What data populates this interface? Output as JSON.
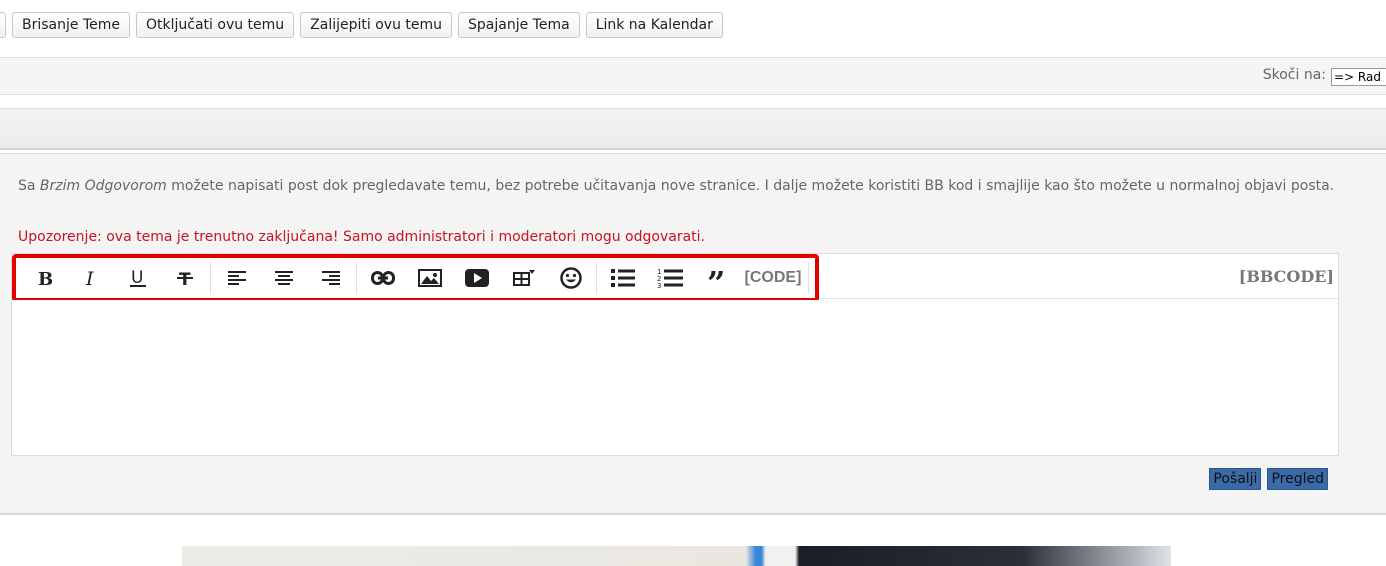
{
  "moderation": {
    "buttons": [
      "Brisanje Teme",
      "Otključati ovu temu",
      "Zalijepiti ovu temu",
      "Spajanje Tema",
      "Link na Kalendar"
    ]
  },
  "jump": {
    "label": "Skoči na:",
    "selected": "=> Rad"
  },
  "quick_reply": {
    "intro_prefix": "Sa",
    "intro_em": "Brzim Odgovorom",
    "intro_rest": "možete napisati post dok pregledavate temu, bez potrebe učitavanja nove stranice. I dalje možete koristiti BB kod i smajlije kao što možete u normalnoj objavi posta.",
    "warning": "Upozorenje: ova tema je trenutno zaključana! Samo administratori i moderatori mogu odgovarati.",
    "toolbar": {
      "icons": [
        "bold-icon",
        "italic-icon",
        "underline-icon",
        "strikethrough-icon",
        "align-left-icon",
        "align-center-icon",
        "align-right-icon",
        "link-icon",
        "image-icon",
        "video-icon",
        "table-icon",
        "emoji-icon",
        "bullet-list-icon",
        "numbered-list-icon",
        "quote-icon"
      ],
      "code_label": "[CODE]",
      "bbcode_label": "[BBCODE]",
      "highlight_color": "#e30000"
    },
    "submit_label": "Pošalji",
    "preview_label": "Pregled"
  },
  "colors": {
    "warning": "#c8141e",
    "button_blue": "#3a6ba8"
  }
}
